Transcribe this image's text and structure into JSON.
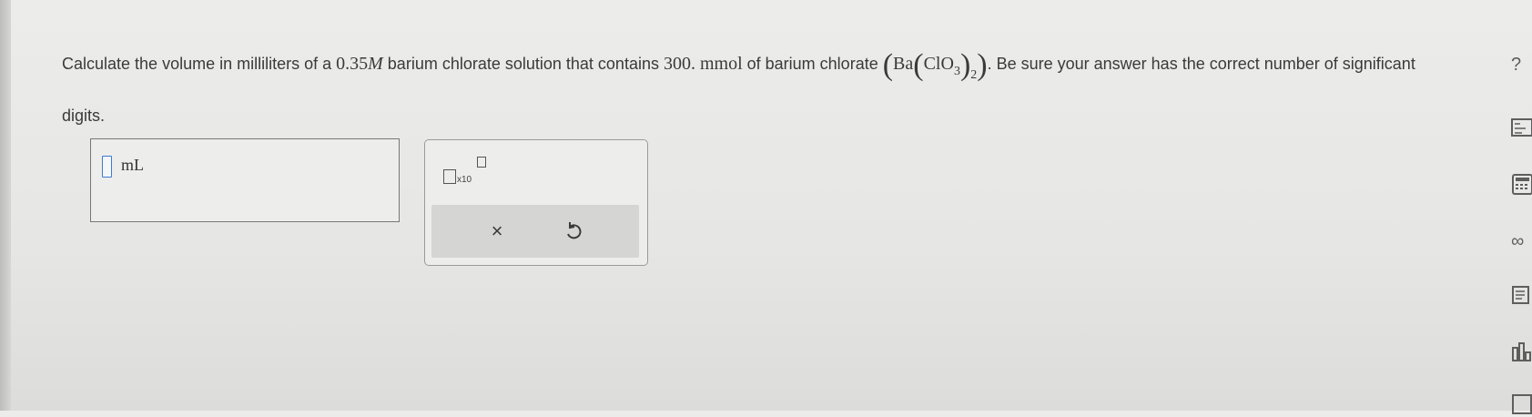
{
  "question": {
    "text_before": "Calculate the volume in milliliters of a ",
    "concentration": "0.35",
    "molarity_unit": "M",
    "text_middle": " barium chlorate solution that contains ",
    "amount": "300.",
    "amount_unit": "mmol",
    "text_compound": " of barium chlorate ",
    "formula_ba": "Ba",
    "formula_clo": "ClO",
    "formula_sub3": "3",
    "formula_sub2": "2",
    "text_after": ". Be sure your answer has the correct number of significant digits."
  },
  "answer": {
    "value": "",
    "unit": "mL"
  },
  "tools": {
    "sci_x10_label": "x10",
    "clear_label": "×",
    "undo_label": "↺"
  },
  "side_toolbar": {
    "icons": [
      "help-icon",
      "periodic-table-icon",
      "calculator-icon",
      "infinity-icon",
      "data-icon",
      "chart-icon",
      "reference-icon"
    ]
  },
  "colors": {
    "answer_slot_border": "#3b7bd0",
    "background": "#e6e6e4"
  }
}
